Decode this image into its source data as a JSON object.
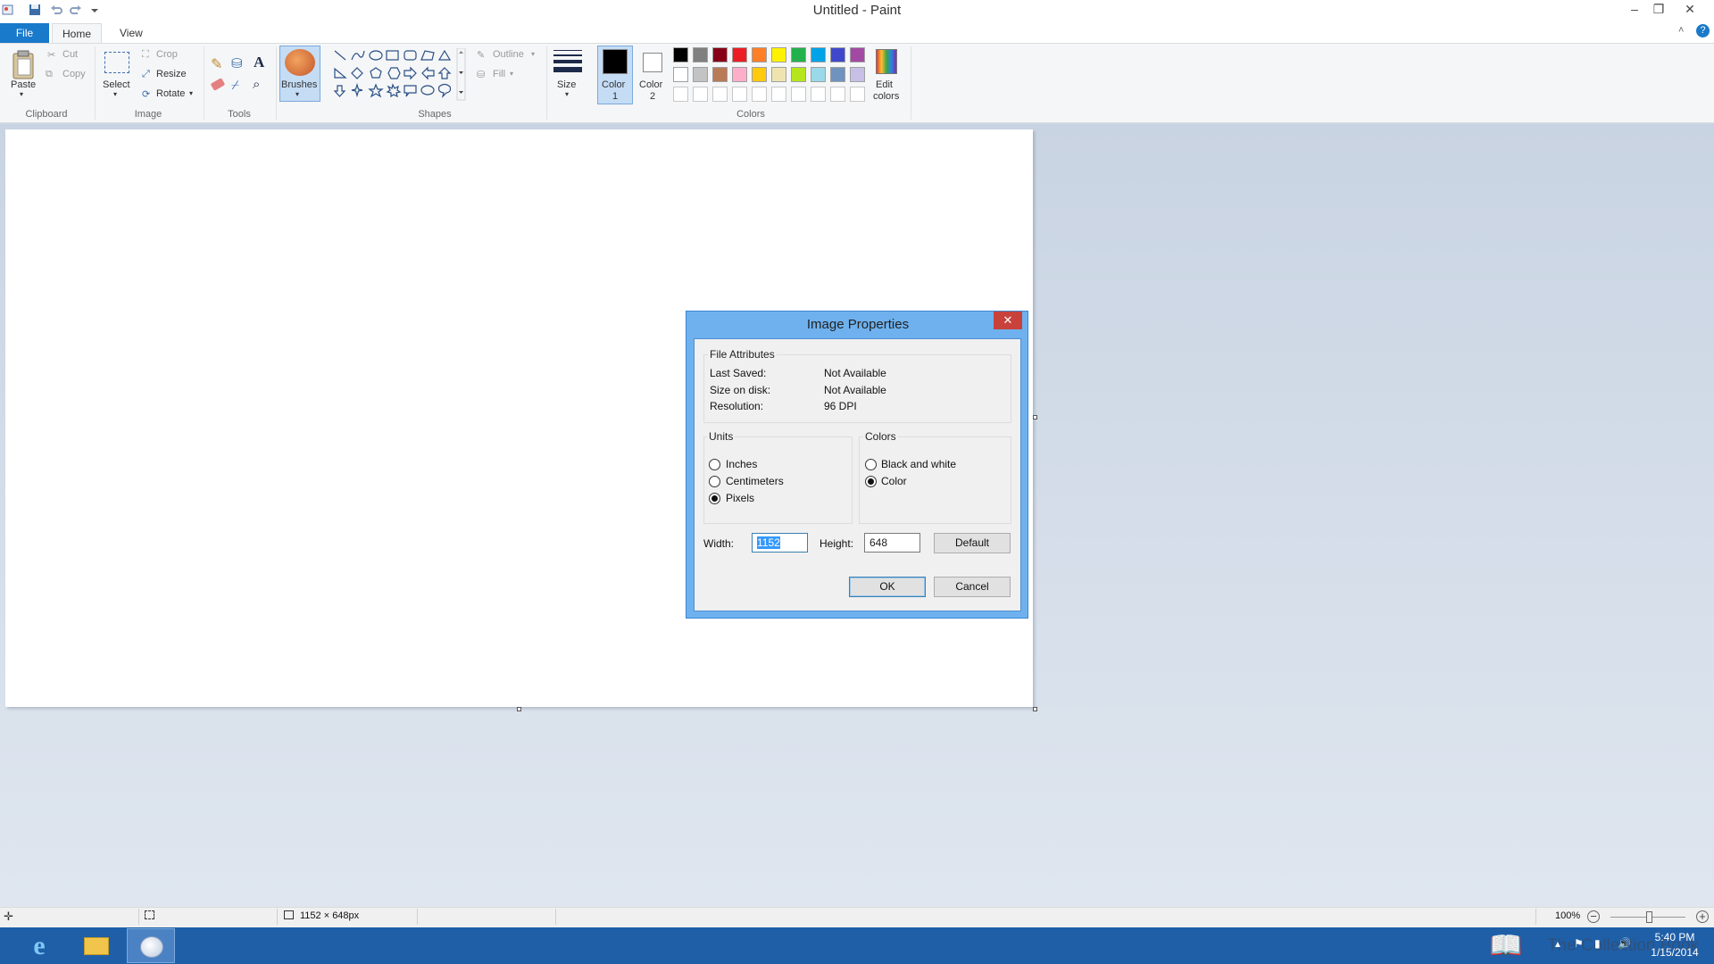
{
  "window": {
    "title": "Untitled - Paint",
    "minimize": "–",
    "restore": "❐",
    "close": "✕"
  },
  "quick_access": [
    "paint-icon",
    "save-icon",
    "undo-icon",
    "redo-icon",
    "customize-qat-icon"
  ],
  "tabs": {
    "file": "File",
    "home": "Home",
    "view": "View"
  },
  "ribbon": {
    "clipboard": {
      "label": "Clipboard",
      "paste": "Paste",
      "cut": "Cut",
      "copy": "Copy"
    },
    "image": {
      "label": "Image",
      "select": "Select",
      "crop": "Crop",
      "resize": "Resize",
      "rotate": "Rotate"
    },
    "tools": {
      "label": "Tools"
    },
    "brushes": "Brushes",
    "shapes": {
      "label": "Shapes",
      "outline": "Outline",
      "fill": "Fill"
    },
    "size": "Size",
    "color1": "Color\n1",
    "color1_a": "Color",
    "color1_b": "1",
    "color2_a": "Color",
    "color2_b": "2",
    "colors_label": "Colors",
    "edit_colors_a": "Edit",
    "edit_colors_b": "colors",
    "palette_row1": [
      "#000000",
      "#7f7f7f",
      "#880015",
      "#ed1c24",
      "#ff7f27",
      "#fff200",
      "#22b14c",
      "#00a2e8",
      "#3f48cc",
      "#a349a4"
    ],
    "palette_row2": [
      "#ffffff",
      "#c3c3c3",
      "#b97a57",
      "#ffaec9",
      "#ffc90e",
      "#efe4b0",
      "#b5e61d",
      "#99d9ea",
      "#7092be",
      "#c8bfe7"
    ],
    "color1_value": "#000000",
    "color2_value": "#ffffff"
  },
  "dialog": {
    "title": "Image Properties",
    "close": "✕",
    "file_attributes": {
      "legend": "File Attributes",
      "last_saved_label": "Last Saved:",
      "last_saved_value": "Not Available",
      "size_label": "Size on disk:",
      "size_value": "Not Available",
      "resolution_label": "Resolution:",
      "resolution_value": "96 DPI"
    },
    "units": {
      "legend": "Units",
      "inches": "Inches",
      "centimeters": "Centimeters",
      "pixels": "Pixels",
      "selected": "Pixels"
    },
    "colors": {
      "legend": "Colors",
      "bw": "Black and white",
      "color": "Color",
      "selected": "Color"
    },
    "width_label": "Width:",
    "width_value": "1152",
    "height_label": "Height:",
    "height_value": "648",
    "default_button": "Default",
    "ok_button": "OK",
    "cancel_button": "Cancel"
  },
  "status": {
    "image_size": "1152 × 648px",
    "zoom": "100%",
    "zoom_level": 1.0
  },
  "taskbar": {
    "apps": [
      "internet-explorer-icon",
      "file-explorer-icon",
      "paint-app-icon"
    ],
    "time": "5:40 PM",
    "date": "1/15/2014",
    "watermark": "The Collection Book"
  }
}
